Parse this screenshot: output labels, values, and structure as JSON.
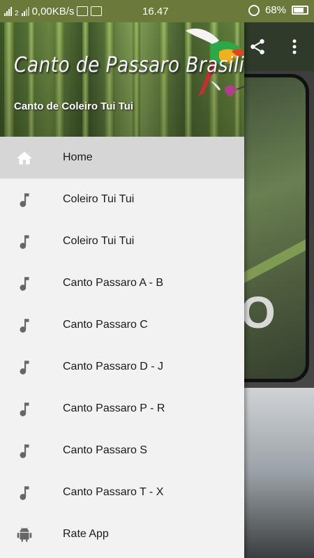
{
  "status_bar": {
    "network_speed": "0,00KB/s",
    "time": "16.47",
    "battery": "68%",
    "sim_label": "2"
  },
  "drawer": {
    "header": {
      "app_name": "Canto de Passaro Brasilios",
      "subtitle": "Canto de Coleiro Tui Tui"
    },
    "items": [
      {
        "label": "Home",
        "icon": "home-icon",
        "active": true
      },
      {
        "label": "Coleiro Tui Tui",
        "icon": "music-note-icon"
      },
      {
        "label": "Coleiro Tui Tui",
        "icon": "music-note-icon"
      },
      {
        "label": "Canto Passaro A - B",
        "icon": "music-note-icon"
      },
      {
        "label": "Canto Passaro C",
        "icon": "music-note-icon"
      },
      {
        "label": "Canto Passaro D - J",
        "icon": "music-note-icon"
      },
      {
        "label": "Canto Passaro P - R",
        "icon": "music-note-icon"
      },
      {
        "label": "Canto Passaro S",
        "icon": "music-note-icon"
      },
      {
        "label": "Canto Passaro T - X",
        "icon": "music-note-icon"
      },
      {
        "label": "Rate App",
        "icon": "android-icon"
      }
    ]
  },
  "background": {
    "card_text": "O"
  },
  "colors": {
    "status_bar": "#6b7a3a",
    "drawer_bg": "#f2f2f2",
    "active_item": "#d6d6d6",
    "icon_gray": "#666666"
  }
}
